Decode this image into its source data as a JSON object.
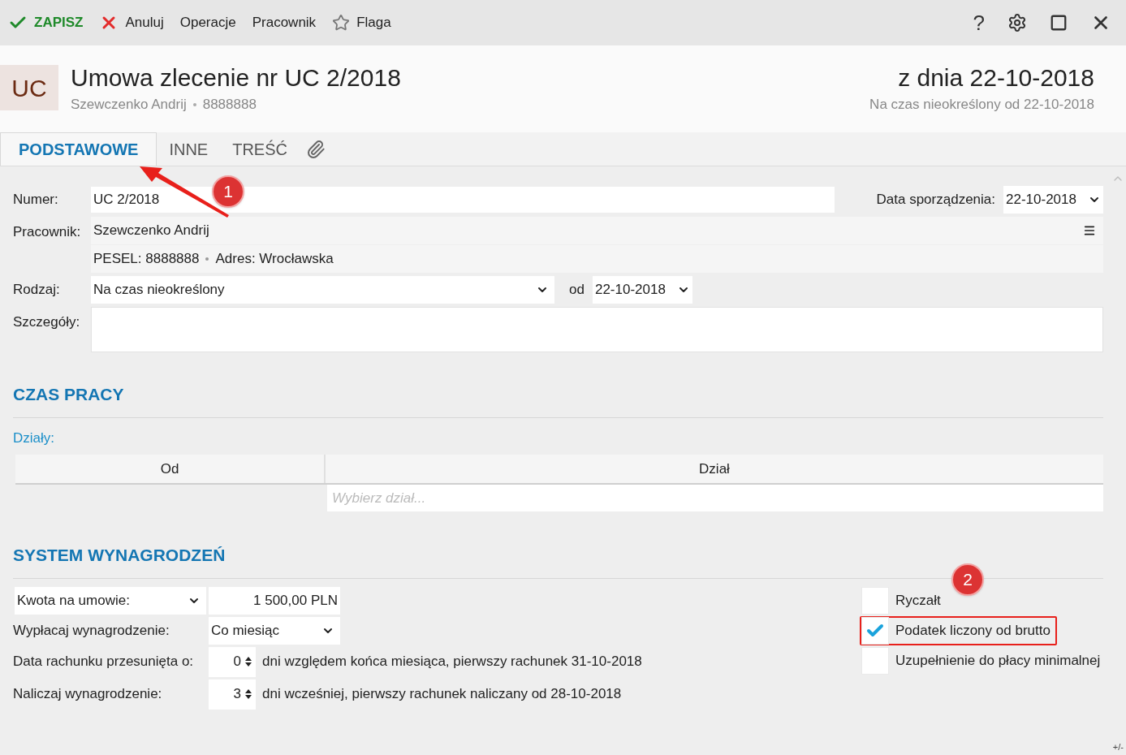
{
  "toolbar": {
    "save": "ZAPISZ",
    "cancel": "Anuluj",
    "items": [
      "Operacje",
      "Pracownik"
    ],
    "flag": "Flaga",
    "help": "?"
  },
  "header": {
    "badge": "UC",
    "title": "Umowa zlecenie nr UC 2/2018",
    "employee": "Szewczenko Andrij",
    "employee_id": "8888888",
    "date_title": "z dnia 22-10-2018",
    "period": "Na czas nieokreślony od 22-10-2018"
  },
  "tabs": [
    {
      "label": "PODSTAWOWE",
      "selected": true
    },
    {
      "label": "INNE",
      "selected": false
    },
    {
      "label": "TREŚĆ",
      "selected": false
    }
  ],
  "form": {
    "numer_label": "Numer:",
    "numer": "UC 2/2018",
    "date_label": "Data sporządzenia:",
    "date": "22-10-2018",
    "employee_label": "Pracownik:",
    "employee": "Szewczenko Andrij",
    "pesel_label": "PESEL:",
    "pesel": "8888888",
    "address_label": "Adres:",
    "address": "Wrocławska",
    "type_label": "Rodzaj:",
    "type": "Na czas nieokreślony",
    "from_label": "od",
    "from": "22-10-2018",
    "details_label": "Szczegóły:"
  },
  "work_time": {
    "heading": "CZAS PRACY",
    "departments_label": "Działy:",
    "columns": [
      "Od",
      "Dział"
    ],
    "placeholder": "Wybierz dział..."
  },
  "pay": {
    "heading": "SYSTEM WYNAGRODZEŃ",
    "amount_mode": "Kwota na umowie:",
    "amount": "1 500,00 PLN",
    "pay_label": "Wypłacaj wynagrodzenie:",
    "pay_freq": "Co miesiąc",
    "shift_label": "Data rachunku przesunięta o:",
    "shift": "0",
    "shift_note": "dni względem końca miesiąca, pierwszy rachunek 31-10-2018",
    "calc_label": "Naliczaj wynagrodzenie:",
    "calc": "3",
    "calc_note": "dni wcześniej, pierwszy rachunek naliczany od 28-10-2018",
    "options": [
      {
        "label": "Ryczałt",
        "checked": false,
        "highlighted": false
      },
      {
        "label": "Podatek liczony od brutto",
        "checked": true,
        "highlighted": true
      },
      {
        "label": "Uzupełnienie do płacy minimalnej",
        "checked": false,
        "highlighted": false
      }
    ]
  },
  "annotations": [
    "1",
    "2"
  ],
  "footer": "+/-"
}
